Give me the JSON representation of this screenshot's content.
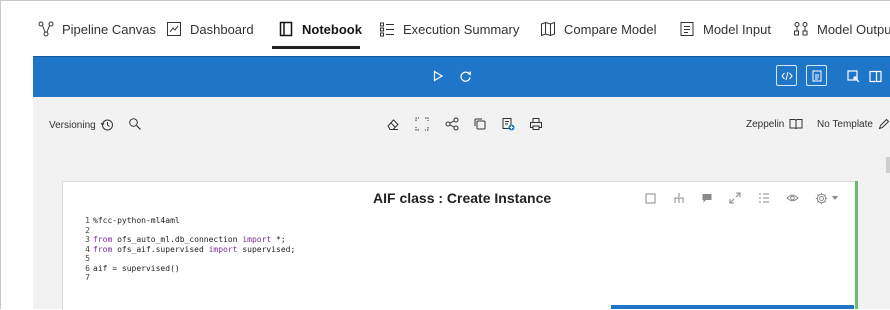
{
  "tabs": [
    {
      "label": "Pipeline Canvas",
      "icon": "pipeline-icon"
    },
    {
      "label": "Dashboard",
      "icon": "dashboard-icon"
    },
    {
      "label": "Notebook",
      "icon": "notebook-icon",
      "active": true
    },
    {
      "label": "Execution Summary",
      "icon": "list-icon"
    },
    {
      "label": "Compare Model",
      "icon": "map-icon"
    },
    {
      "label": "Model Input",
      "icon": "form-icon"
    },
    {
      "label": "Model Outpu",
      "icon": "org-icon"
    }
  ],
  "toolbar": {
    "versioning_label": "Versioning",
    "zeppelin_label": "Zeppelin",
    "template_label": "No Template"
  },
  "paragraph": {
    "title": "AIF class : Create Instance",
    "code_lines": [
      {
        "n": "1",
        "text": "%fcc-python-ml4aml"
      },
      {
        "n": "2",
        "text": ""
      },
      {
        "n": "3",
        "pre": "",
        "kw1": "from",
        "mid": " ofs_auto_ml.db_connection ",
        "kw2": "import",
        "post": " *;"
      },
      {
        "n": "4",
        "pre": "",
        "kw1": "from",
        "mid": " ofs_aif.supervised ",
        "kw2": "import",
        "post": " supervised;"
      },
      {
        "n": "5",
        "text": ""
      },
      {
        "n": "6",
        "text": "aif = supervised()"
      },
      {
        "n": "7",
        "text": ""
      }
    ]
  },
  "colors": {
    "toolbar_blue": "#1f76c9",
    "paragraph_status_green": "#6cbf6a",
    "keyword_purple": "#7a2a99"
  }
}
